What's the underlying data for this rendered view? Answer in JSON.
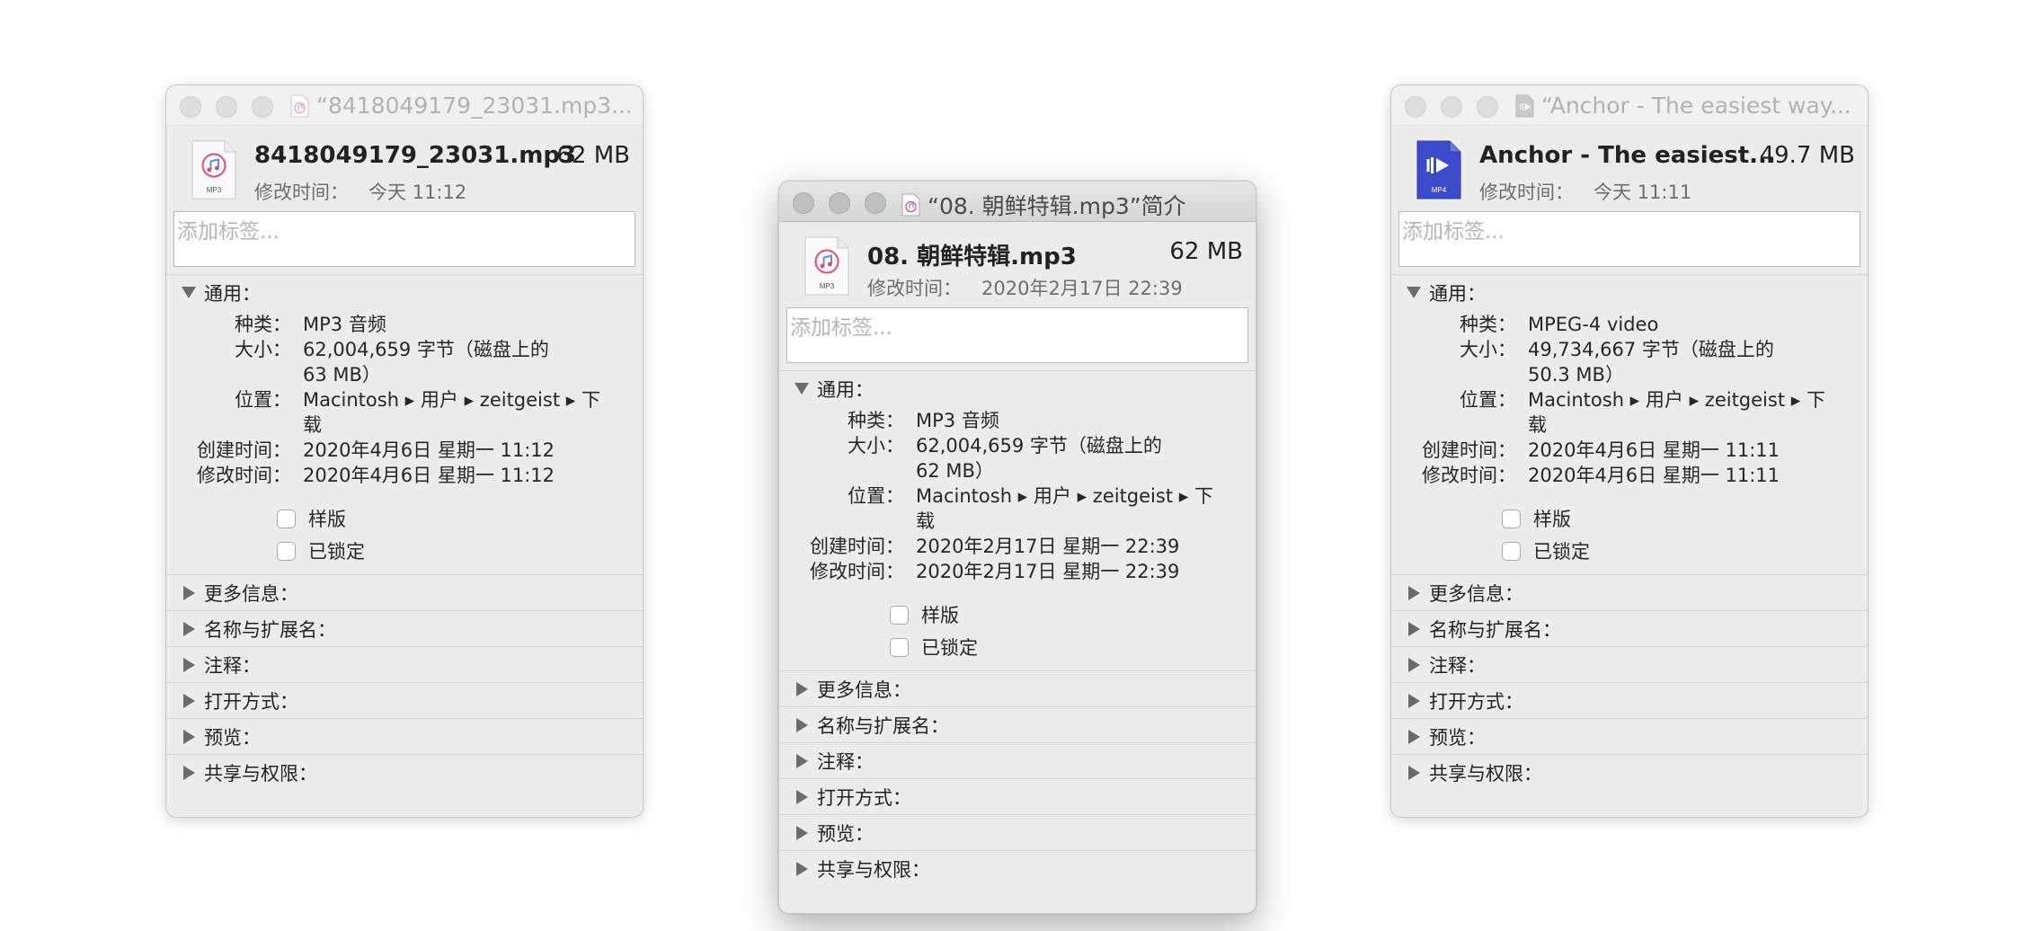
{
  "windows": [
    {
      "title": "“8418049179_23031.mp3...",
      "name": "8418049179_23031.mp3",
      "size": "62 MB",
      "icon_label": "MP3",
      "modified_label": "修改时间：",
      "modified_value": "今天 11:12",
      "tags_placeholder": "添加标签...",
      "general_label": "通用：",
      "kind_label": "种类：",
      "kind": "MP3 音频",
      "size_label": "大小：",
      "size_detail": "62,004,659 字节（磁盘上的 63 MB）",
      "where_label": "位置：",
      "where": "Macintosh ▸ 用户 ▸ zeitgeist ▸ 下载",
      "created_label": "创建时间：",
      "created": "2020年4月6日 星期一 11:12",
      "modified2_label": "修改时间：",
      "modified2": "2020年4月6日 星期一 11:12",
      "stationery": "样版",
      "locked": "已锁定",
      "more_info": "更多信息：",
      "name_ext": "名称与扩展名：",
      "comments": "注释：",
      "open_with": "打开方式：",
      "preview": "预览：",
      "sharing": "共享与权限："
    },
    {
      "title": "“08. 朝鲜特辑.mp3”简介",
      "name": "08. 朝鲜特辑.mp3",
      "size": "62 MB",
      "icon_label": "MP3",
      "modified_label": "修改时间：",
      "modified_value": "2020年2月17日 22:39",
      "tags_placeholder": "添加标签...",
      "general_label": "通用：",
      "kind_label": "种类：",
      "kind": "MP3 音频",
      "size_label": "大小：",
      "size_detail": "62,004,659 字节（磁盘上的 62 MB）",
      "where_label": "位置：",
      "where": "Macintosh ▸ 用户 ▸ zeitgeist ▸ 下载",
      "created_label": "创建时间：",
      "created": "2020年2月17日 星期一 22:39",
      "modified2_label": "修改时间：",
      "modified2": "2020年2月17日 星期一 22:39",
      "stationery": "样版",
      "locked": "已锁定",
      "more_info": "更多信息：",
      "name_ext": "名称与扩展名：",
      "comments": "注释：",
      "open_with": "打开方式：",
      "preview": "预览：",
      "sharing": "共享与权限："
    },
    {
      "title": "“Anchor - The easiest way...",
      "name": "Anchor - The easiest...",
      "size": "49.7 MB",
      "icon_label": "MP4",
      "modified_label": "修改时间：",
      "modified_value": "今天 11:11",
      "tags_placeholder": "添加标签...",
      "general_label": "通用：",
      "kind_label": "种类：",
      "kind": "MPEG-4 video",
      "size_label": "大小：",
      "size_detail": "49,734,667 字节（磁盘上的 50.3 MB）",
      "where_label": "位置：",
      "where": "Macintosh ▸ 用户 ▸ zeitgeist ▸ 下载",
      "created_label": "创建时间：",
      "created": "2020年4月6日 星期一 11:11",
      "modified2_label": "修改时间：",
      "modified2": "2020年4月6日 星期一 11:11",
      "stationery": "样版",
      "locked": "已锁定",
      "more_info": "更多信息：",
      "name_ext": "名称与扩展名：",
      "comments": "注释：",
      "open_with": "打开方式：",
      "preview": "预览：",
      "sharing": "共享与权限："
    }
  ],
  "colors": {
    "mp4_icon": "#3b4bc9",
    "itunes_pink": "#e8457c",
    "itunes_blue": "#5b8df5"
  }
}
